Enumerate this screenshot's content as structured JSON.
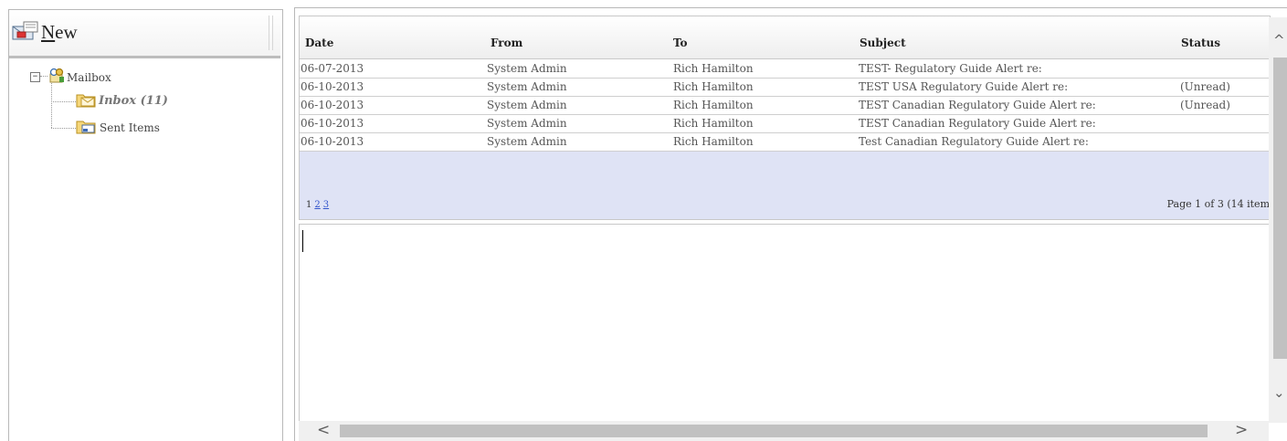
{
  "toolbar": {
    "new_label_first": "N",
    "new_label_rest": "ew"
  },
  "tree": {
    "root": {
      "label": "Mailbox",
      "toggle": "−"
    },
    "folders": [
      {
        "label": "Inbox (11)"
      },
      {
        "label": "Sent Items"
      }
    ]
  },
  "grid": {
    "columns": [
      "Date",
      "From",
      "To",
      "Subject",
      "Status"
    ],
    "rows": [
      {
        "date": "06-07-2013",
        "from": "System Admin",
        "to": "Rich Hamilton",
        "subject": "TEST- Regulatory Guide Alert re:",
        "status": ""
      },
      {
        "date": "06-10-2013",
        "from": "System Admin",
        "to": "Rich Hamilton",
        "subject": "TEST USA Regulatory Guide Alert re:",
        "status": "(Unread)"
      },
      {
        "date": "06-10-2013",
        "from": "System Admin",
        "to": "Rich Hamilton",
        "subject": "TEST Canadian Regulatory Guide Alert re:",
        "status": "(Unread)"
      },
      {
        "date": "06-10-2013",
        "from": "System Admin",
        "to": "Rich Hamilton",
        "subject": "TEST Canadian Regulatory Guide Alert re:",
        "status": ""
      },
      {
        "date": "06-10-2013",
        "from": "System Admin",
        "to": "Rich Hamilton",
        "subject": "Test Canadian Regulatory Guide Alert re:",
        "status": ""
      }
    ],
    "pager": {
      "current": "1",
      "links": [
        "2",
        "3"
      ],
      "info": "Page 1 of 3 (14 item"
    }
  },
  "scroll": {
    "up": "^",
    "down": "⌄",
    "left": "<",
    "right": ">"
  }
}
